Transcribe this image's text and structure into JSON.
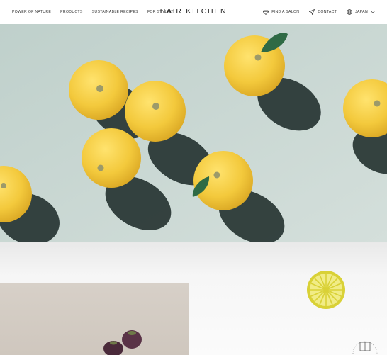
{
  "header": {
    "nav_left": [
      "POWER OF NATURE",
      "PRODUCTS",
      "SUSTAINABLE RECIPES",
      "FOR STYLIST"
    ],
    "logo": "HAIR KITCHEN",
    "find_salon": "FIND A SALON",
    "contact": "CONTACT",
    "region": "JAPAN"
  },
  "icons": [
    "diamond-icon",
    "send-icon",
    "globe-icon",
    "chevron-down-icon",
    "lemon-slice-icon",
    "book-icon"
  ],
  "colors": {
    "hero_background": "#c7d6d1",
    "citrus": "#f2c94c",
    "lemon_badge": "#d9d136"
  }
}
